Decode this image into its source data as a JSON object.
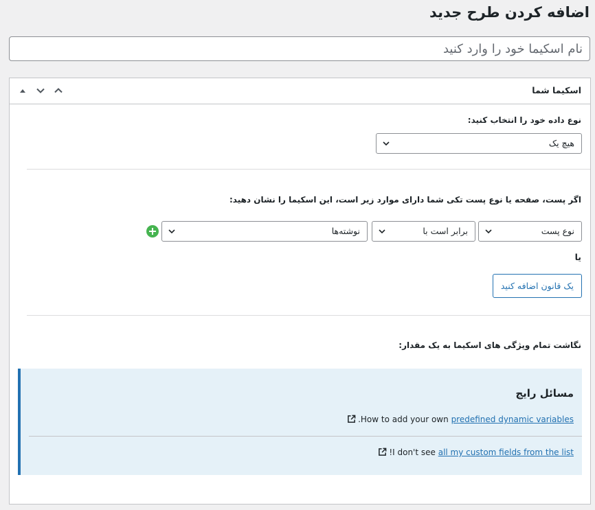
{
  "page": {
    "title": "اضافه کردن طرح جدید"
  },
  "name_field": {
    "placeholder": "نام اسکیما خود را وارد کنید",
    "value": ""
  },
  "postbox": {
    "title": "اسکیما شما",
    "data_type_label": "نوع داده خود را انتخاب کنید:",
    "data_type_value": "هیچ یک",
    "location_label": "اگر پست، صفحه یا نوع پست تکی شما دارای موارد زیر است، این اسکیما را نشان دهید:",
    "rule": {
      "param": "نوع پست",
      "operator": "برابر است با",
      "value": "نوشته‌ها"
    },
    "or_label": "یا",
    "add_rule_label": "یک قانون اضافه کنید",
    "map_label": "نگاشت تمام ویژگی های اسکیما به یک مقدار:"
  },
  "notice": {
    "title": "مسائل رایج",
    "row1": {
      "text": "How to add your own",
      "link": "predefined dynamic variables",
      "suffix": "."
    },
    "row2": {
      "text": "I don't see",
      "link": "all my custom fields from the list",
      "suffix": "!"
    }
  },
  "colors": {
    "accent": "#2271b1",
    "success": "#46b450",
    "notice_bg": "#e5f1f8"
  },
  "icons": [
    "triangle-up-icon",
    "chevron-down-icon",
    "chevron-up-icon",
    "plus-circle-icon",
    "external-link-icon"
  ]
}
